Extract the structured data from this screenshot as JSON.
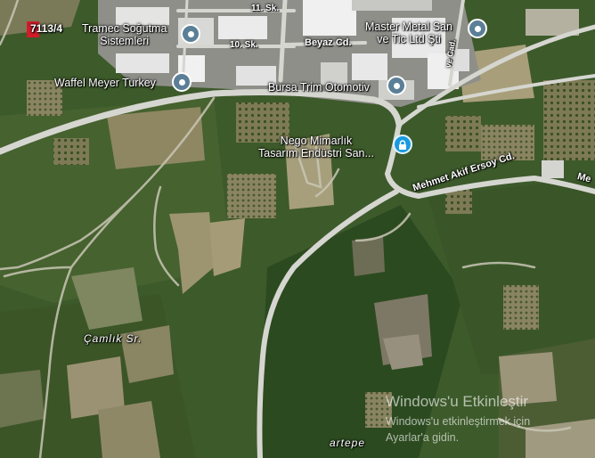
{
  "map": {
    "colors": {
      "vegetation_dark": "#2f4a22",
      "vegetation_mid": "#4a6533",
      "field_brown": "#8d8460",
      "road": "#d9d9d4",
      "building_roof": "#e6e6e6",
      "pin_fill": "#5b7f96",
      "lock_pin_fill": "#1a9be0"
    },
    "parcel_label": "7113/4",
    "pois": [
      {
        "name_line1": "Tramec Soğutma",
        "name_line2": "Sistemleri",
        "icon": "place-pin-icon"
      },
      {
        "name_line1": "Master Metal San",
        "name_line2": "ve Tic Ltd Şti",
        "icon": "place-pin-icon"
      },
      {
        "name_line1": "Waffel Meyer Turkey",
        "name_line2": "",
        "icon": "place-pin-icon"
      },
      {
        "name_line1": "Bursa Trim Otomotiv",
        "name_line2": "",
        "icon": "place-pin-icon"
      },
      {
        "name_line1": "Nego Mimarlık",
        "name_line2": "Tasarım Endüstri San...",
        "icon": "lock-pin-icon"
      }
    ],
    "streets": {
      "s11": "11. Sk.",
      "s10": "10. Sk.",
      "beyaz": "Beyaz Cd.",
      "mehmet_akif": "Mehmet Akif Ersoy Cd.",
      "mehmet_akif_cut": "Me",
      "vertical_cut": "ve Cad.",
      "camlik": "Çamlık Sr.",
      "artepe": "artepe"
    }
  },
  "watermark": {
    "title": "Windows'u Etkinleştir",
    "line1": "Windows'u etkinleştirmek için",
    "line2": "Ayarlar'a gidin."
  }
}
